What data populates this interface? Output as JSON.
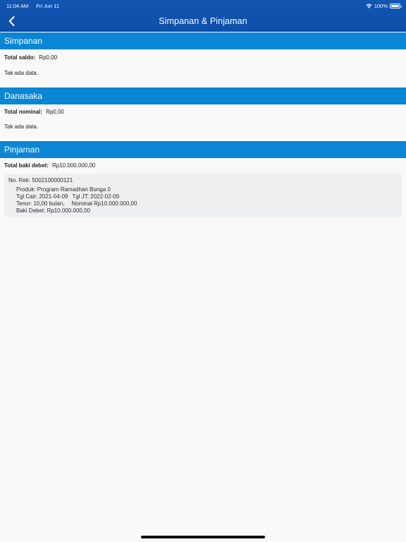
{
  "status_bar": {
    "time": "11:04 AM",
    "date": "Fri Jun 11",
    "battery": "100%",
    "icons": [
      "wifi-icon",
      "battery-icon"
    ]
  },
  "header": {
    "title": "Simpanan & Pinjaman",
    "back_icon": "chevron-left-icon"
  },
  "colors": {
    "header_bg": "#1256b3",
    "section_bg": "#0a86d4",
    "card_bg": "#eeeff0",
    "page_bg": "#f9f9fa"
  },
  "simpanan": {
    "title": "Simpanan",
    "summary_label": "Total saldo:",
    "summary_value": "Rp0,00",
    "empty": "Tak ada data."
  },
  "danasaka": {
    "title": "Danasaka",
    "summary_label": "Total nominal:",
    "summary_value": "Rp0,00",
    "empty": "Tak ada data."
  },
  "pinjaman": {
    "title": "Pinjaman",
    "summary_label": "Total baki debet:",
    "summary_value": "Rp10.000.000,00",
    "loans": [
      {
        "account": "No. Rek: 5002100000121",
        "product": "Produk: Program Ramadhan Bunga 0",
        "tgl_cair": "Tgl Cair: 2021-04-09",
        "tgl_jt": "Tgl JT: 2022-02-09",
        "tenor": "Tenor: 10,00 bulan,",
        "nominal": "Nominal Rp10.000.000,00",
        "baki_debet": "Baki Debet: Rp10.000.000,00"
      }
    ]
  }
}
